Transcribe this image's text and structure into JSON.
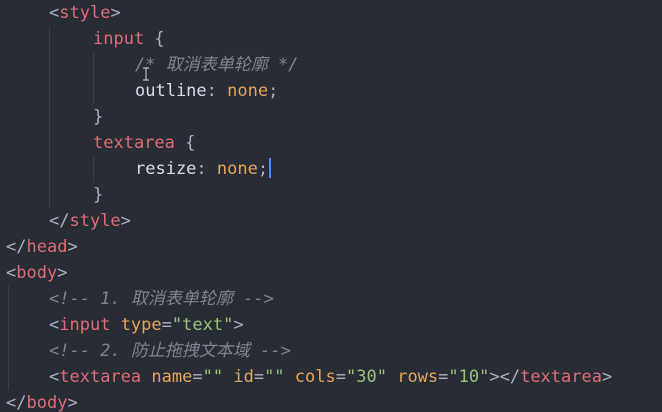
{
  "editor": {
    "colors": {
      "background": "#282C35",
      "tag": "#E06C75",
      "property": "#D8DEE9",
      "value": "#E5A55B",
      "string": "#98C379",
      "comment": "#7F848E",
      "punctuation": "#ABB2BF",
      "cursor": "#528BFF"
    },
    "lines": {
      "l1": {
        "lt": "<",
        "tag": "style",
        "gt": ">"
      },
      "l2": {
        "sel": "input",
        "brace": " {"
      },
      "l3": {
        "comment": "/* 取消表单轮廓 */"
      },
      "l4": {
        "prop": "outline",
        "colon": ": ",
        "val": "none",
        "semi": ";"
      },
      "l5": {
        "brace": "}"
      },
      "l6": {
        "sel": "textarea",
        "brace": " {"
      },
      "l7": {
        "prop": "resize",
        "colon": ": ",
        "val": "none",
        "semi": ";"
      },
      "l8": {
        "brace": "}"
      },
      "l9": {
        "lt": "</",
        "tag": "style",
        "gt": ">"
      },
      "l10": {
        "lt": "</",
        "tag": "head",
        "gt": ">"
      },
      "l11": {
        "lt": "<",
        "tag": "body",
        "gt": ">"
      },
      "l12": {
        "comment": "<!-- 1. 取消表单轮廓 -->"
      },
      "l13": {
        "lt": "<",
        "tag": "input",
        "sp": " ",
        "attr": "type",
        "eq": "=",
        "str": "\"text\"",
        "gt": ">"
      },
      "l14": {
        "comment": "<!-- 2. 防止拖拽文本域 -->"
      },
      "l15": {
        "lt": "<",
        "tag": "textarea",
        "a1": "name",
        "s1": "\"\"",
        "a2": "id",
        "s2": "\"\"",
        "a3": "cols",
        "s3": "\"30\"",
        "a4": "rows",
        "s4": "\"10\"",
        "close": "></",
        "tag2": "textarea",
        "gt": ">"
      },
      "l16": {
        "lt": "</",
        "tag": "body",
        "gt": ">"
      }
    }
  }
}
